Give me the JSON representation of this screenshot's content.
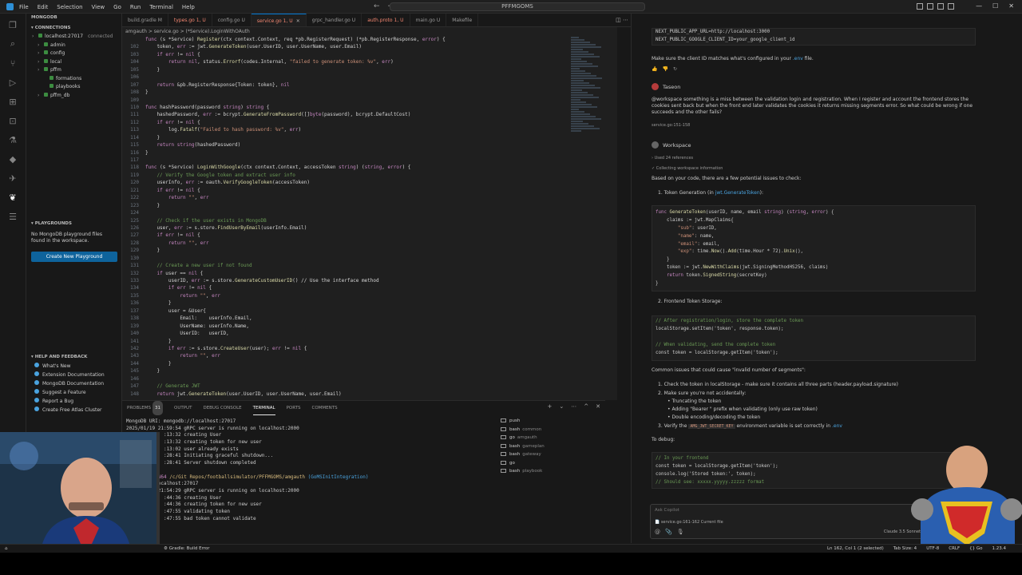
{
  "window_title": "PFFMGOMS",
  "menu": [
    "File",
    "Edit",
    "Selection",
    "View",
    "Go",
    "Run",
    "Terminal",
    "Help"
  ],
  "activity_icons": [
    "explorer-icon",
    "search-icon",
    "source-control-icon",
    "run-debug-icon",
    "extensions-icon",
    "remote-icon",
    "testing-icon",
    "docker-icon",
    "chat-icon",
    "mongodb-leaf-icon",
    "database-icon"
  ],
  "sidebar": {
    "title": "MONGODB",
    "connections_header": "CONNECTIONS",
    "tree": [
      {
        "label": "localhost:27017",
        "extra": "connected",
        "indent": 1
      },
      {
        "label": "admin",
        "indent": 2
      },
      {
        "label": "config",
        "indent": 2
      },
      {
        "label": "local",
        "indent": 2
      },
      {
        "label": "pffm",
        "indent": 2
      },
      {
        "label": "formations",
        "indent": 3
      },
      {
        "label": "playbooks",
        "indent": 3
      },
      {
        "label": "pffm_db",
        "indent": 2
      }
    ],
    "playgrounds_header": "PLAYGROUNDS",
    "playgrounds_msg": "No MongoDB playground files found in the workspace.",
    "create_playground": "Create New Playground",
    "help_header": "HELP AND FEEDBACK",
    "help_items": [
      "What's New",
      "Extension Documentation",
      "MongoDB Documentation",
      "Suggest a Feature",
      "Report a Bug",
      "Create Free Atlas Cluster"
    ]
  },
  "tabs": [
    {
      "label": "build.gradle",
      "badge": "M",
      "active": false
    },
    {
      "label": "types.go",
      "badge": "1, U",
      "active": false,
      "err": true
    },
    {
      "label": "config.go",
      "badge": "U",
      "active": false
    },
    {
      "label": "service.go",
      "badge": "1, U",
      "active": true,
      "err": true
    },
    {
      "label": "grpc_handler.go",
      "badge": "U",
      "active": false
    },
    {
      "label": "auth.proto",
      "badge": "1, U",
      "active": false,
      "err": true
    },
    {
      "label": "main.go",
      "badge": "U",
      "active": false
    },
    {
      "label": "Makefile",
      "badge": "",
      "active": false
    }
  ],
  "breadcrumb": "amgauth > service.go > (*Service).LoginWithOAuth",
  "code_lines": [
    {
      "n": "",
      "t": "func (s *Service) Register(ctx context.Context, req *pb.RegisterRequest) (*pb.RegisterResponse, error) {"
    },
    {
      "n": "102",
      "t": "    token, err := jwt.GenerateToken(user.UserID, user.UserName, user.Email)"
    },
    {
      "n": "103",
      "t": "    if err != nil {"
    },
    {
      "n": "104",
      "t": "        return nil, status.Errorf(codes.Internal, \"failed to generate token: %v\", err)"
    },
    {
      "n": "105",
      "t": "    }"
    },
    {
      "n": "106",
      "t": ""
    },
    {
      "n": "107",
      "t": "    return &pb.RegisterResponse{Token: token}, nil"
    },
    {
      "n": "108",
      "t": "}"
    },
    {
      "n": "109",
      "t": ""
    },
    {
      "n": "110",
      "t": "func hashPassword(password string) string {"
    },
    {
      "n": "111",
      "t": "    hashedPassword, err := bcrypt.GenerateFromPassword([]byte(password), bcrypt.DefaultCost)"
    },
    {
      "n": "112",
      "t": "    if err != nil {"
    },
    {
      "n": "113",
      "t": "        log.Fatalf(\"Failed to hash password: %v\", err)"
    },
    {
      "n": "114",
      "t": "    }"
    },
    {
      "n": "115",
      "t": "    return string(hashedPassword)"
    },
    {
      "n": "116",
      "t": "}"
    },
    {
      "n": "117",
      "t": ""
    },
    {
      "n": "118",
      "t": "func (s *Service) LoginWithGoogle(ctx context.Context, accessToken string) (string, error) {"
    },
    {
      "n": "119",
      "t": "    // Verify the Google token and extract user info"
    },
    {
      "n": "120",
      "t": "    userInfo, err := oauth.VerifyGoogleToken(accessToken)"
    },
    {
      "n": "121",
      "t": "    if err != nil {"
    },
    {
      "n": "122",
      "t": "        return \"\", err"
    },
    {
      "n": "123",
      "t": "    }"
    },
    {
      "n": "124",
      "t": ""
    },
    {
      "n": "125",
      "t": "    // Check if the user exists in MongoDB"
    },
    {
      "n": "126",
      "t": "    user, err := s.store.FindUserByEmail(userInfo.Email)"
    },
    {
      "n": "127",
      "t": "    if err != nil {"
    },
    {
      "n": "128",
      "t": "        return \"\", err"
    },
    {
      "n": "129",
      "t": "    }"
    },
    {
      "n": "130",
      "t": ""
    },
    {
      "n": "131",
      "t": "    // Create a new user if not found"
    },
    {
      "n": "132",
      "t": "    if user == nil {"
    },
    {
      "n": "133",
      "t": "        userID, err := s.store.GenerateCustomUserID() // Use the interface method"
    },
    {
      "n": "134",
      "t": "        if err != nil {"
    },
    {
      "n": "135",
      "t": "            return \"\", err"
    },
    {
      "n": "136",
      "t": "        }"
    },
    {
      "n": "137",
      "t": "        user = &User{"
    },
    {
      "n": "138",
      "t": "            Email:    userInfo.Email,"
    },
    {
      "n": "139",
      "t": "            UserName: userInfo.Name,"
    },
    {
      "n": "140",
      "t": "            UserID:   userID,"
    },
    {
      "n": "141",
      "t": "        }"
    },
    {
      "n": "142",
      "t": "        if err := s.store.CreateUser(user); err != nil {"
    },
    {
      "n": "143",
      "t": "            return \"\", err"
    },
    {
      "n": "144",
      "t": "        }"
    },
    {
      "n": "145",
      "t": "    }"
    },
    {
      "n": "146",
      "t": ""
    },
    {
      "n": "147",
      "t": "    // Generate JWT"
    },
    {
      "n": "148",
      "t": "    return jwt.GenerateToken(user.UserID, user.UserName, user.Email)"
    }
  ],
  "panel": {
    "tabs": [
      "PROBLEMS",
      "OUTPUT",
      "DEBUG CONSOLE",
      "TERMINAL",
      "PORTS",
      "COMMENTS"
    ],
    "problems_count": "31",
    "active": "TERMINAL"
  },
  "terminal_lines": [
    "MongoDB URI: mongodb://localhost:27017",
    "2025/01/19 21:59:54 gRPC server is running on localhost:2000",
    "             :13:32 creating User",
    "             :13:32 creating token for new user",
    "             :13:02 user already exists",
    "             :28:41 Initiating graceful shutdown...",
    "             :28:41 Server shutdown completed",
    "",
    "PATH_LINE",
    "mongodb://localhost:27017",
    "2025/01/19 21:54:29 gRPC server is running on localhost:2000",
    "             :44:36 creating User",
    "             :44:36 creating token for new user",
    "             :47:55 validating token",
    "             :47:55 bad token cannot validate"
  ],
  "terminal_prompt": {
    "user": "rsBase",
    "host": "MINGW64",
    "path": "/c/Git Repos/footballsimulator/PFFMGOMS/amgauth",
    "branch": "(GoMSInitIntegration)"
  },
  "terminal_list": [
    {
      "name": "push",
      "sub": ""
    },
    {
      "name": "bash",
      "sub": "common"
    },
    {
      "name": "go",
      "sub": "amgauth"
    },
    {
      "name": "bash",
      "sub": "gameplan"
    },
    {
      "name": "bash",
      "sub": "gateway"
    },
    {
      "name": "go",
      "sub": ""
    },
    {
      "name": "bash",
      "sub": "playbook"
    }
  ],
  "chat": {
    "env_line1": "NEXT_PUBLIC_APP_URL=http://localhost:3000",
    "env_line2": "NEXT_PUBLIC_GOOGLE_CLIENT_ID=your_google_client_id",
    "client_note": "Make sure the client ID matches what's configured in your",
    "client_note_file": ".env",
    "client_note_end": "file.",
    "user_name": "Taseon",
    "user_msg": "@workspace something is a miss between the validation login and registration. When I register and account the frontend stores the cookies sent back but when the front end later validates the cookies it returns missing segments error. So what could be wrong if one succeeds and the other fails?",
    "user_ref": "service.go:151-158",
    "ws_name": "Workspace",
    "ws_used": "Used 24 references",
    "ws_collect": "Collecting workspace information",
    "intro": "Based on your code, there are a few potential issues to check:",
    "item1": "1. Token Generation (in",
    "item1_file": "jwt.GenerateToken",
    "item1_end": "):",
    "code1": [
      "func GenerateToken(userID, name, email string) (string, error) {",
      "    claims := jwt.MapClaims{",
      "        \"sub\": userID,",
      "        \"name\": name,",
      "        \"email\": email,",
      "        \"exp\": time.Now().Add(time.Hour * 72).Unix(),",
      "    }",
      "    token := jwt.NewWithClaims(jwt.SigningMethodHS256, claims)",
      "    return token.SignedString(secretKey)",
      "}"
    ],
    "item2": "2. Frontend Token Storage:",
    "code2": [
      "// After registration/login, store the complete token",
      "localStorage.setItem('token', response.token);",
      "",
      "// When validating, send the complete token",
      "const token = localStorage.getItem('token');"
    ],
    "common": "Common issues that could cause \"invalid number of segments\":",
    "c1": "1. Check the token in localStorage - make sure it contains all three parts (header.payload.signature)",
    "c2": "2. Make sure you're not accidentally:",
    "c2a": "Truncating the token",
    "c2b": "Adding \"Bearer \" prefix when validating (only use raw token)",
    "c2c": "Double encoding/decoding the token",
    "c3": "3. Verify the",
    "c3_code": "AMG_JWT_SECRET_KEY",
    "c3_end": "environment variable is set correctly in",
    "c3_file": ".env",
    "debug": "To debug:",
    "code3": [
      "// In your frontend",
      "const token = localStorage.getItem('token');",
      "console.log('Stored token:', token);",
      "// Should see: xxxxx.yyyyy.zzzzz format"
    ],
    "ask_placeholder": "Ask Copilot",
    "ask_ref": "service.go:161-162 Current file",
    "model": "Claude 3.5 Sonnet"
  },
  "status": {
    "left": "Gradle: Build Error",
    "right_items": [
      "Ln 162, Col 1 (2 selected)",
      "Tab Size: 4",
      "UTF-8",
      "CRLF",
      "{} Go",
      "1.23.4"
    ]
  },
  "colors": {
    "accent": "#0078d4",
    "button": "#0e639c"
  }
}
